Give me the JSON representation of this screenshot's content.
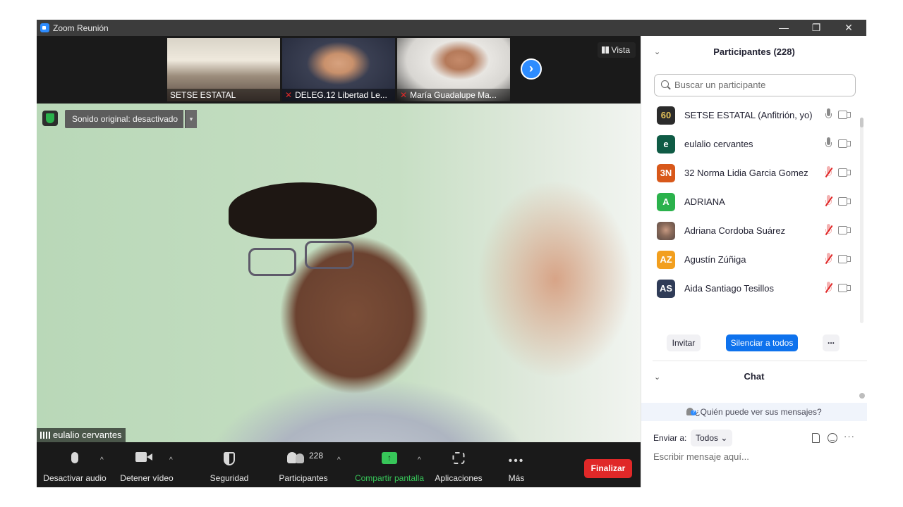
{
  "window": {
    "title": "Zoom Reunión",
    "controls": {
      "minimize": "—",
      "restore": "❐",
      "close": "✕"
    }
  },
  "gallery": {
    "thumbnails": [
      {
        "name": "SETSE ESTATAL",
        "muted": false
      },
      {
        "name": "DELEG.12 Libertad Le...",
        "muted": true
      },
      {
        "name": "María Guadalupe Ma...",
        "muted": true
      }
    ],
    "next_label": "›",
    "view_label": "Vista"
  },
  "main_video": {
    "audio_status": "Sonido original: desactivado",
    "audio_dropdown": "▾",
    "speaker": "eulalio cervantes"
  },
  "toolbar": {
    "audio_label": "Desactivar audio",
    "video_label": "Detener vídeo",
    "security_label": "Seguridad",
    "participants_label": "Participantes",
    "participants_count": "228",
    "share_label": "Compartir pantalla",
    "share_icon": "↑",
    "apps_label": "Aplicaciones",
    "more_label": "Más",
    "more_icon": "•••",
    "end_label": "Finalizar",
    "caret": "^"
  },
  "participants_panel": {
    "title": "Participantes (228)",
    "collapse_icon": "⌄",
    "search_placeholder": "Buscar un participante",
    "participants": [
      {
        "initials": "60",
        "name": "SETSE ESTATAL (Anfitrión, yo)",
        "color": "#2b2b2b",
        "muted": false
      },
      {
        "initials": "e",
        "name": "eulalio cervantes",
        "color": "#0f5b45",
        "muted": false
      },
      {
        "initials": "3N",
        "name": "32 Norma Lidia Garcia Gomez",
        "color": "#d8581a",
        "muted": true
      },
      {
        "initials": "A",
        "name": "ADRIANA",
        "color": "#2bb24c",
        "muted": true
      },
      {
        "initials": "",
        "name": "Adriana Cordoba Suárez",
        "color": "#8a6a5a",
        "muted": true
      },
      {
        "initials": "AZ",
        "name": "Agustín Zúñiga",
        "color": "#f29f1e",
        "muted": true
      },
      {
        "initials": "AS",
        "name": "Aida Santiago Tesillos",
        "color": "#2f3b57",
        "muted": true
      }
    ],
    "invite_label": "Invitar",
    "mute_all_label": "Silenciar a todos",
    "more_label": "..."
  },
  "chat": {
    "title": "Chat",
    "who_can_see": "¿Quién puede ver sus mensajes?",
    "send_to_label": "Enviar a:",
    "send_to_value": "Todos",
    "send_to_caret": "⌄",
    "more_icon": "···",
    "input_placeholder": "Escribir mensaje aquí..."
  },
  "colors": {
    "accent": "#2d8cff",
    "end_button": "#e02828",
    "share_green": "#37c659",
    "primary_button": "#0e72ed"
  }
}
